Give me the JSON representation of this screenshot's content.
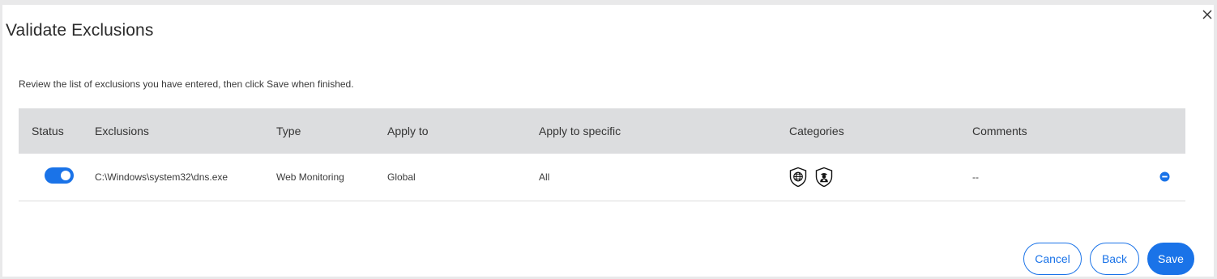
{
  "dialog": {
    "title": "Validate Exclusions",
    "instructions": "Review the list of exclusions you have entered, then click Save when finished.",
    "close_icon": "close-icon"
  },
  "table": {
    "columns": [
      "Status",
      "Exclusions",
      "Type",
      "Apply to",
      "Apply to specific",
      "Categories",
      "Comments"
    ],
    "rows": [
      {
        "status_enabled": true,
        "exclusion": "C:\\Windows\\system32\\dns.exe",
        "type": "Web Monitoring",
        "apply_to": "Global",
        "apply_to_specific": "All",
        "category_icons": [
          "globe-shield-icon",
          "person-shield-icon"
        ],
        "comments": "--",
        "remove_icon": "remove-circle-icon"
      }
    ]
  },
  "footer": {
    "cancel_label": "Cancel",
    "back_label": "Back",
    "save_label": "Save"
  },
  "colors": {
    "accent": "#1a73e8",
    "header_bg": "#dcdddf",
    "page_bg": "#e9e9ea"
  }
}
